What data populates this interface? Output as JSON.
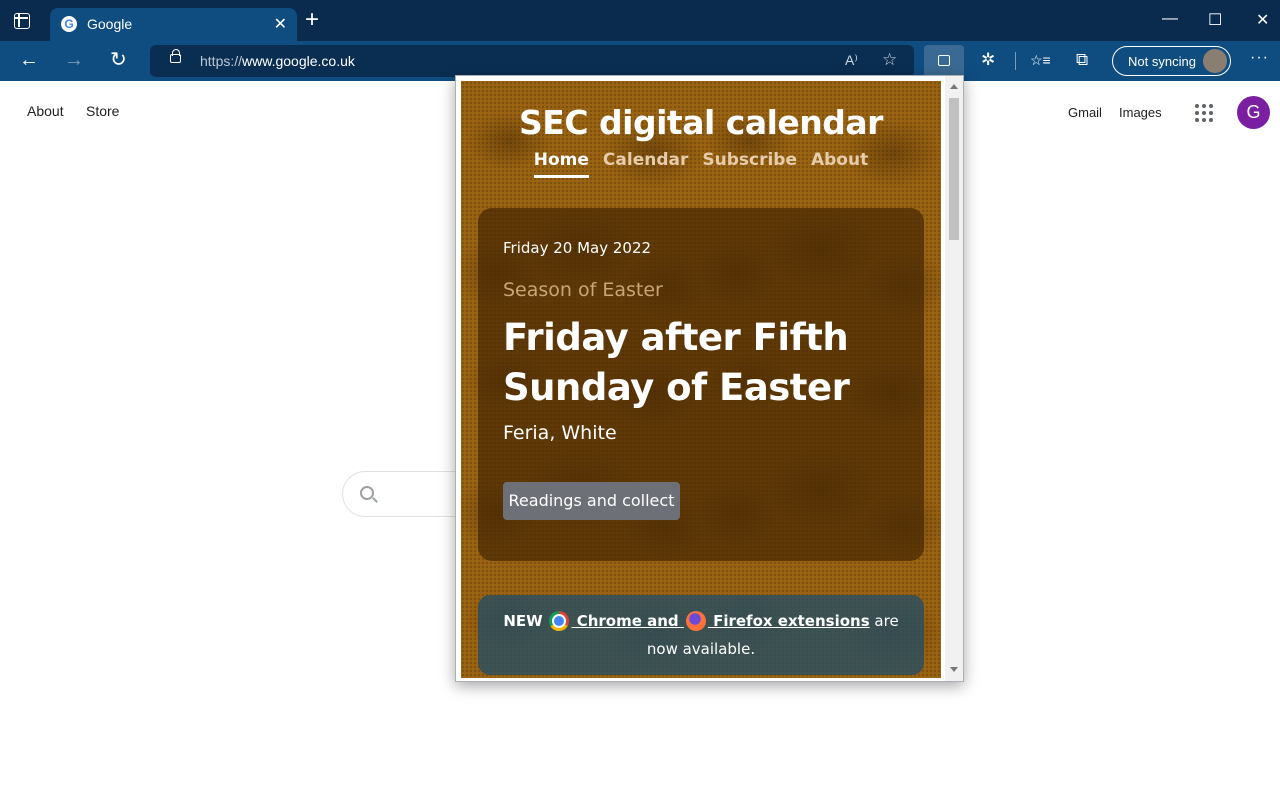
{
  "browser": {
    "tab": {
      "title": "Google",
      "favicon": "google-g-icon",
      "close": "✕"
    },
    "new_tab": "+",
    "window": {
      "minimize": "—",
      "maximize": "☐",
      "close": "✕"
    },
    "nav": {
      "back": "←",
      "forward": "→",
      "refresh": "↻"
    },
    "address": {
      "scheme": "https://",
      "host": "www.google.co.uk"
    },
    "toolbar_icons": {
      "read_aloud": "A⁾",
      "add_favorite": "☆",
      "extensions": "✲",
      "favorites": "☆≡",
      "collections": "⧉",
      "more": "···"
    },
    "sync_label": "Not syncing",
    "accent": "#0f4d80"
  },
  "google": {
    "left_links": [
      "About",
      "Store"
    ],
    "right_links": [
      "Gmail",
      "Images"
    ],
    "avatar_letter": "G",
    "avatar_color": "#7b1fa2"
  },
  "popup": {
    "site_title": "SEC digital calendar",
    "nav": [
      "Home",
      "Calendar",
      "Subscribe",
      "About"
    ],
    "active_nav": "Home",
    "day": {
      "date": "Friday 20 May 2022",
      "season": "Season of Easter",
      "title": "Friday after Fifth Sunday of Easter",
      "rank": "Feria, White"
    },
    "readings_button": "Readings and collect",
    "notice": {
      "new": "NEW",
      "link_chrome": " Chrome and ",
      "link_firefox": " Firefox extensions",
      "tail1": " are",
      "tail2": "now available."
    },
    "background_color": "#9b6412"
  }
}
